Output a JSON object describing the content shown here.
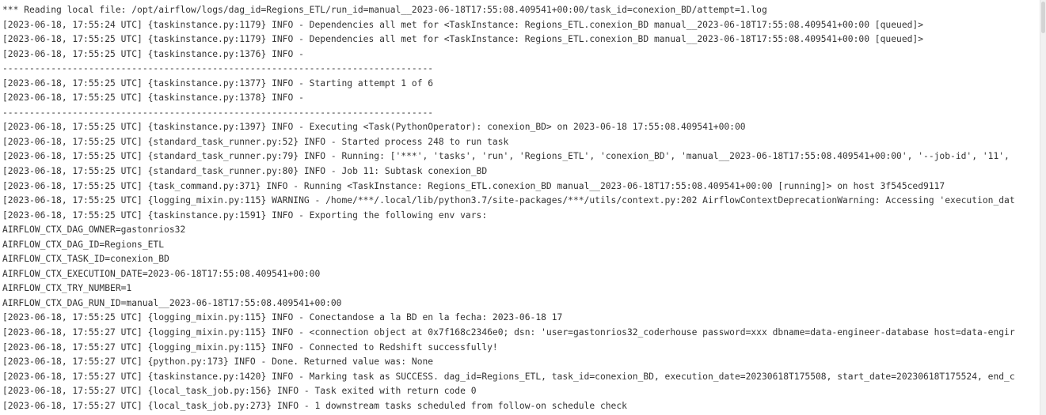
{
  "log": {
    "lines": [
      "*** Reading local file: /opt/airflow/logs/dag_id=Regions_ETL/run_id=manual__2023-06-18T17:55:08.409541+00:00/task_id=conexion_BD/attempt=1.log",
      "[2023-06-18, 17:55:24 UTC] {taskinstance.py:1179} INFO - Dependencies all met for <TaskInstance: Regions_ETL.conexion_BD manual__2023-06-18T17:55:08.409541+00:00 [queued]>",
      "[2023-06-18, 17:55:25 UTC] {taskinstance.py:1179} INFO - Dependencies all met for <TaskInstance: Regions_ETL.conexion_BD manual__2023-06-18T17:55:08.409541+00:00 [queued]>",
      "[2023-06-18, 17:55:25 UTC] {taskinstance.py:1376} INFO - ",
      "--------------------------------------------------------------------------------",
      "[2023-06-18, 17:55:25 UTC] {taskinstance.py:1377} INFO - Starting attempt 1 of 6",
      "[2023-06-18, 17:55:25 UTC] {taskinstance.py:1378} INFO - ",
      "--------------------------------------------------------------------------------",
      "[2023-06-18, 17:55:25 UTC] {taskinstance.py:1397} INFO - Executing <Task(PythonOperator): conexion_BD> on 2023-06-18 17:55:08.409541+00:00",
      "[2023-06-18, 17:55:25 UTC] {standard_task_runner.py:52} INFO - Started process 248 to run task",
      "[2023-06-18, 17:55:25 UTC] {standard_task_runner.py:79} INFO - Running: ['***', 'tasks', 'run', 'Regions_ETL', 'conexion_BD', 'manual__2023-06-18T17:55:08.409541+00:00', '--job-id', '11',",
      "[2023-06-18, 17:55:25 UTC] {standard_task_runner.py:80} INFO - Job 11: Subtask conexion_BD",
      "[2023-06-18, 17:55:25 UTC] {task_command.py:371} INFO - Running <TaskInstance: Regions_ETL.conexion_BD manual__2023-06-18T17:55:08.409541+00:00 [running]> on host 3f545ced9117",
      "[2023-06-18, 17:55:25 UTC] {logging_mixin.py:115} WARNING - /home/***/.local/lib/python3.7/site-packages/***/utils/context.py:202 AirflowContextDeprecationWarning: Accessing 'execution_dat",
      "[2023-06-18, 17:55:25 UTC] {taskinstance.py:1591} INFO - Exporting the following env vars:",
      "AIRFLOW_CTX_DAG_OWNER=gastonrios32",
      "AIRFLOW_CTX_DAG_ID=Regions_ETL",
      "AIRFLOW_CTX_TASK_ID=conexion_BD",
      "AIRFLOW_CTX_EXECUTION_DATE=2023-06-18T17:55:08.409541+00:00",
      "AIRFLOW_CTX_TRY_NUMBER=1",
      "AIRFLOW_CTX_DAG_RUN_ID=manual__2023-06-18T17:55:08.409541+00:00",
      "[2023-06-18, 17:55:25 UTC] {logging_mixin.py:115} INFO - Conectandose a la BD en la fecha: 2023-06-18 17",
      "[2023-06-18, 17:55:27 UTC] {logging_mixin.py:115} INFO - <connection object at 0x7f168c2346e0; dsn: 'user=gastonrios32_coderhouse password=xxx dbname=data-engineer-database host=data-engir",
      "[2023-06-18, 17:55:27 UTC] {logging_mixin.py:115} INFO - Connected to Redshift successfully!",
      "[2023-06-18, 17:55:27 UTC] {python.py:173} INFO - Done. Returned value was: None",
      "[2023-06-18, 17:55:27 UTC] {taskinstance.py:1420} INFO - Marking task as SUCCESS. dag_id=Regions_ETL, task_id=conexion_BD, execution_date=20230618T175508, start_date=20230618T175524, end_c",
      "[2023-06-18, 17:55:27 UTC] {local_task_job.py:156} INFO - Task exited with return code 0",
      "[2023-06-18, 17:55:27 UTC] {local_task_job.py:273} INFO - 1 downstream tasks scheduled from follow-on schedule check"
    ]
  }
}
